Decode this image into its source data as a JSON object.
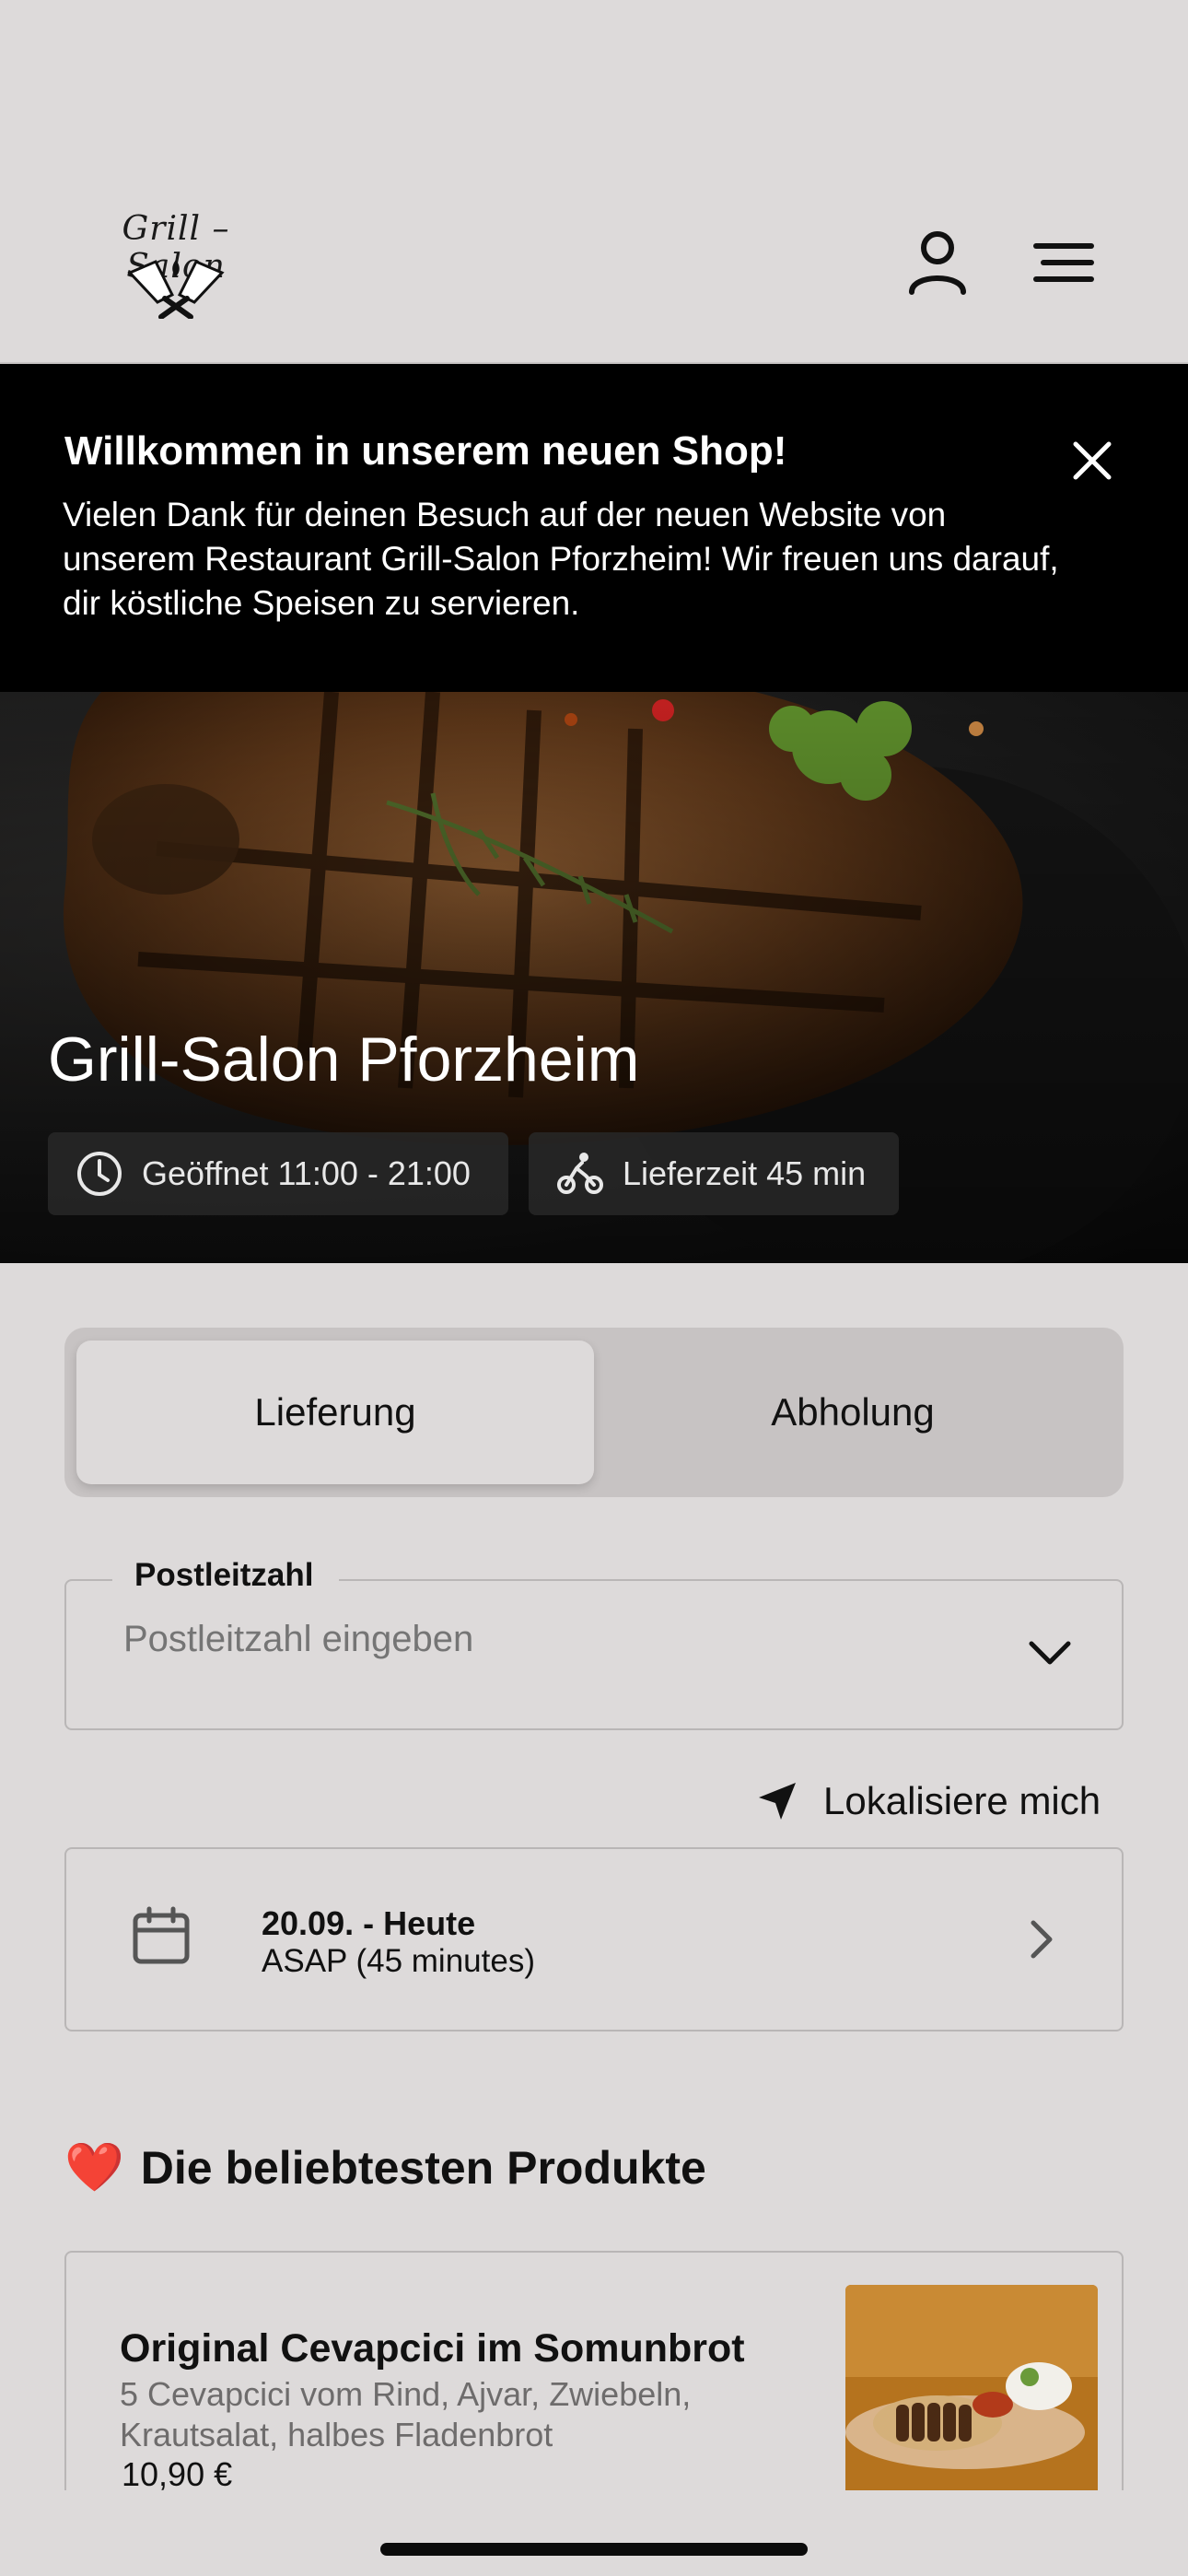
{
  "header": {
    "logo_text": "Grill – Salon",
    "icons": [
      "user-icon",
      "menu-icon"
    ]
  },
  "banner": {
    "title": "Willkommen in unserem neuen Shop!",
    "text": "Vielen Dank für deinen Besuch auf der neuen Website von unserem Restaurant Grill-Salon Pforzheim! Wir freuen uns darauf, dir köstliche Speisen zu servieren."
  },
  "hero": {
    "title": "Grill-Salon Pforzheim",
    "hours": "Geöffnet 11:00 - 21:00",
    "delivery_time": "Lieferzeit 45 min"
  },
  "order_mode": {
    "options": [
      "Lieferung",
      "Abholung"
    ],
    "selected": "Lieferung"
  },
  "postcode": {
    "label": "Postleitzahl",
    "placeholder": "Postleitzahl eingeben"
  },
  "locate": {
    "label": "Lokalisiere mich"
  },
  "schedule": {
    "date": "20.09. - Heute",
    "time": "ASAP (45 minutes)"
  },
  "popular": {
    "heart": "❤️",
    "title": "Die beliebtesten Produkte",
    "products": [
      {
        "name": "Original Cevapcici im Somunbrot",
        "description": "5 Cevapcici vom Rind, Ajvar, Zwiebeln, Krautsalat, halbes Fladenbrot",
        "price": "10,90 €"
      }
    ]
  },
  "colors": {
    "background": "#dddada",
    "banner": "#000000",
    "accent_heart": "#d6172a"
  }
}
